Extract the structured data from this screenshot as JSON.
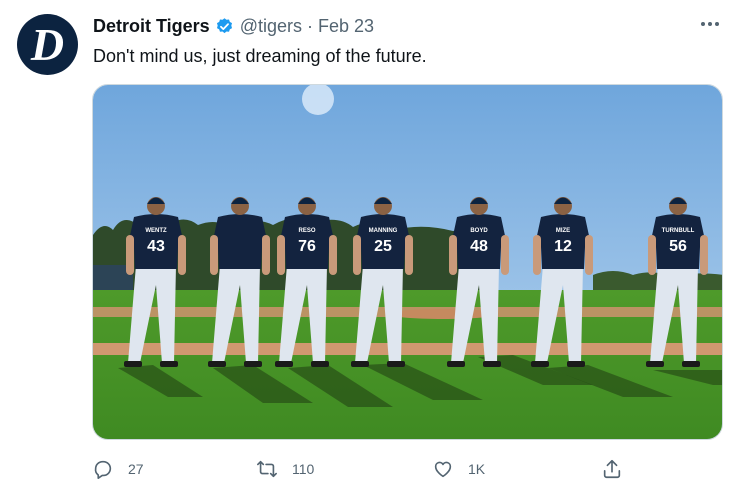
{
  "tweet": {
    "author_name": "Detroit Tigers",
    "handle": "@tigers",
    "separator": "·",
    "date": "Feb 23",
    "text": "Don't mind us, just dreaming of the future.",
    "avatar_icon": "tigers-old-english-d-logo",
    "verified_icon": "verified-badge-icon",
    "more_icon": "more-horizontal-icon"
  },
  "photo": {
    "description_icon": "baseball-players-photo",
    "jerseys": [
      {
        "name": "WENTZ",
        "number": "43"
      },
      {
        "name": "",
        "number": ""
      },
      {
        "name": "RESO",
        "number": "76"
      },
      {
        "name": "MANNING",
        "number": "25"
      },
      {
        "name": "BOYD",
        "number": "48"
      },
      {
        "name": "MIZE",
        "number": "12"
      },
      {
        "name": "TURNBULL",
        "number": "56"
      }
    ]
  },
  "actions": {
    "reply": {
      "icon": "reply-icon",
      "count": "27"
    },
    "retweet": {
      "icon": "retweet-icon",
      "count": "110"
    },
    "like": {
      "icon": "heart-icon",
      "count": "1K"
    },
    "share": {
      "icon": "share-icon"
    }
  },
  "colors": {
    "brand_navy": "#0c2340",
    "verified_blue": "#1d9bf0",
    "secondary_text": "#536471"
  }
}
